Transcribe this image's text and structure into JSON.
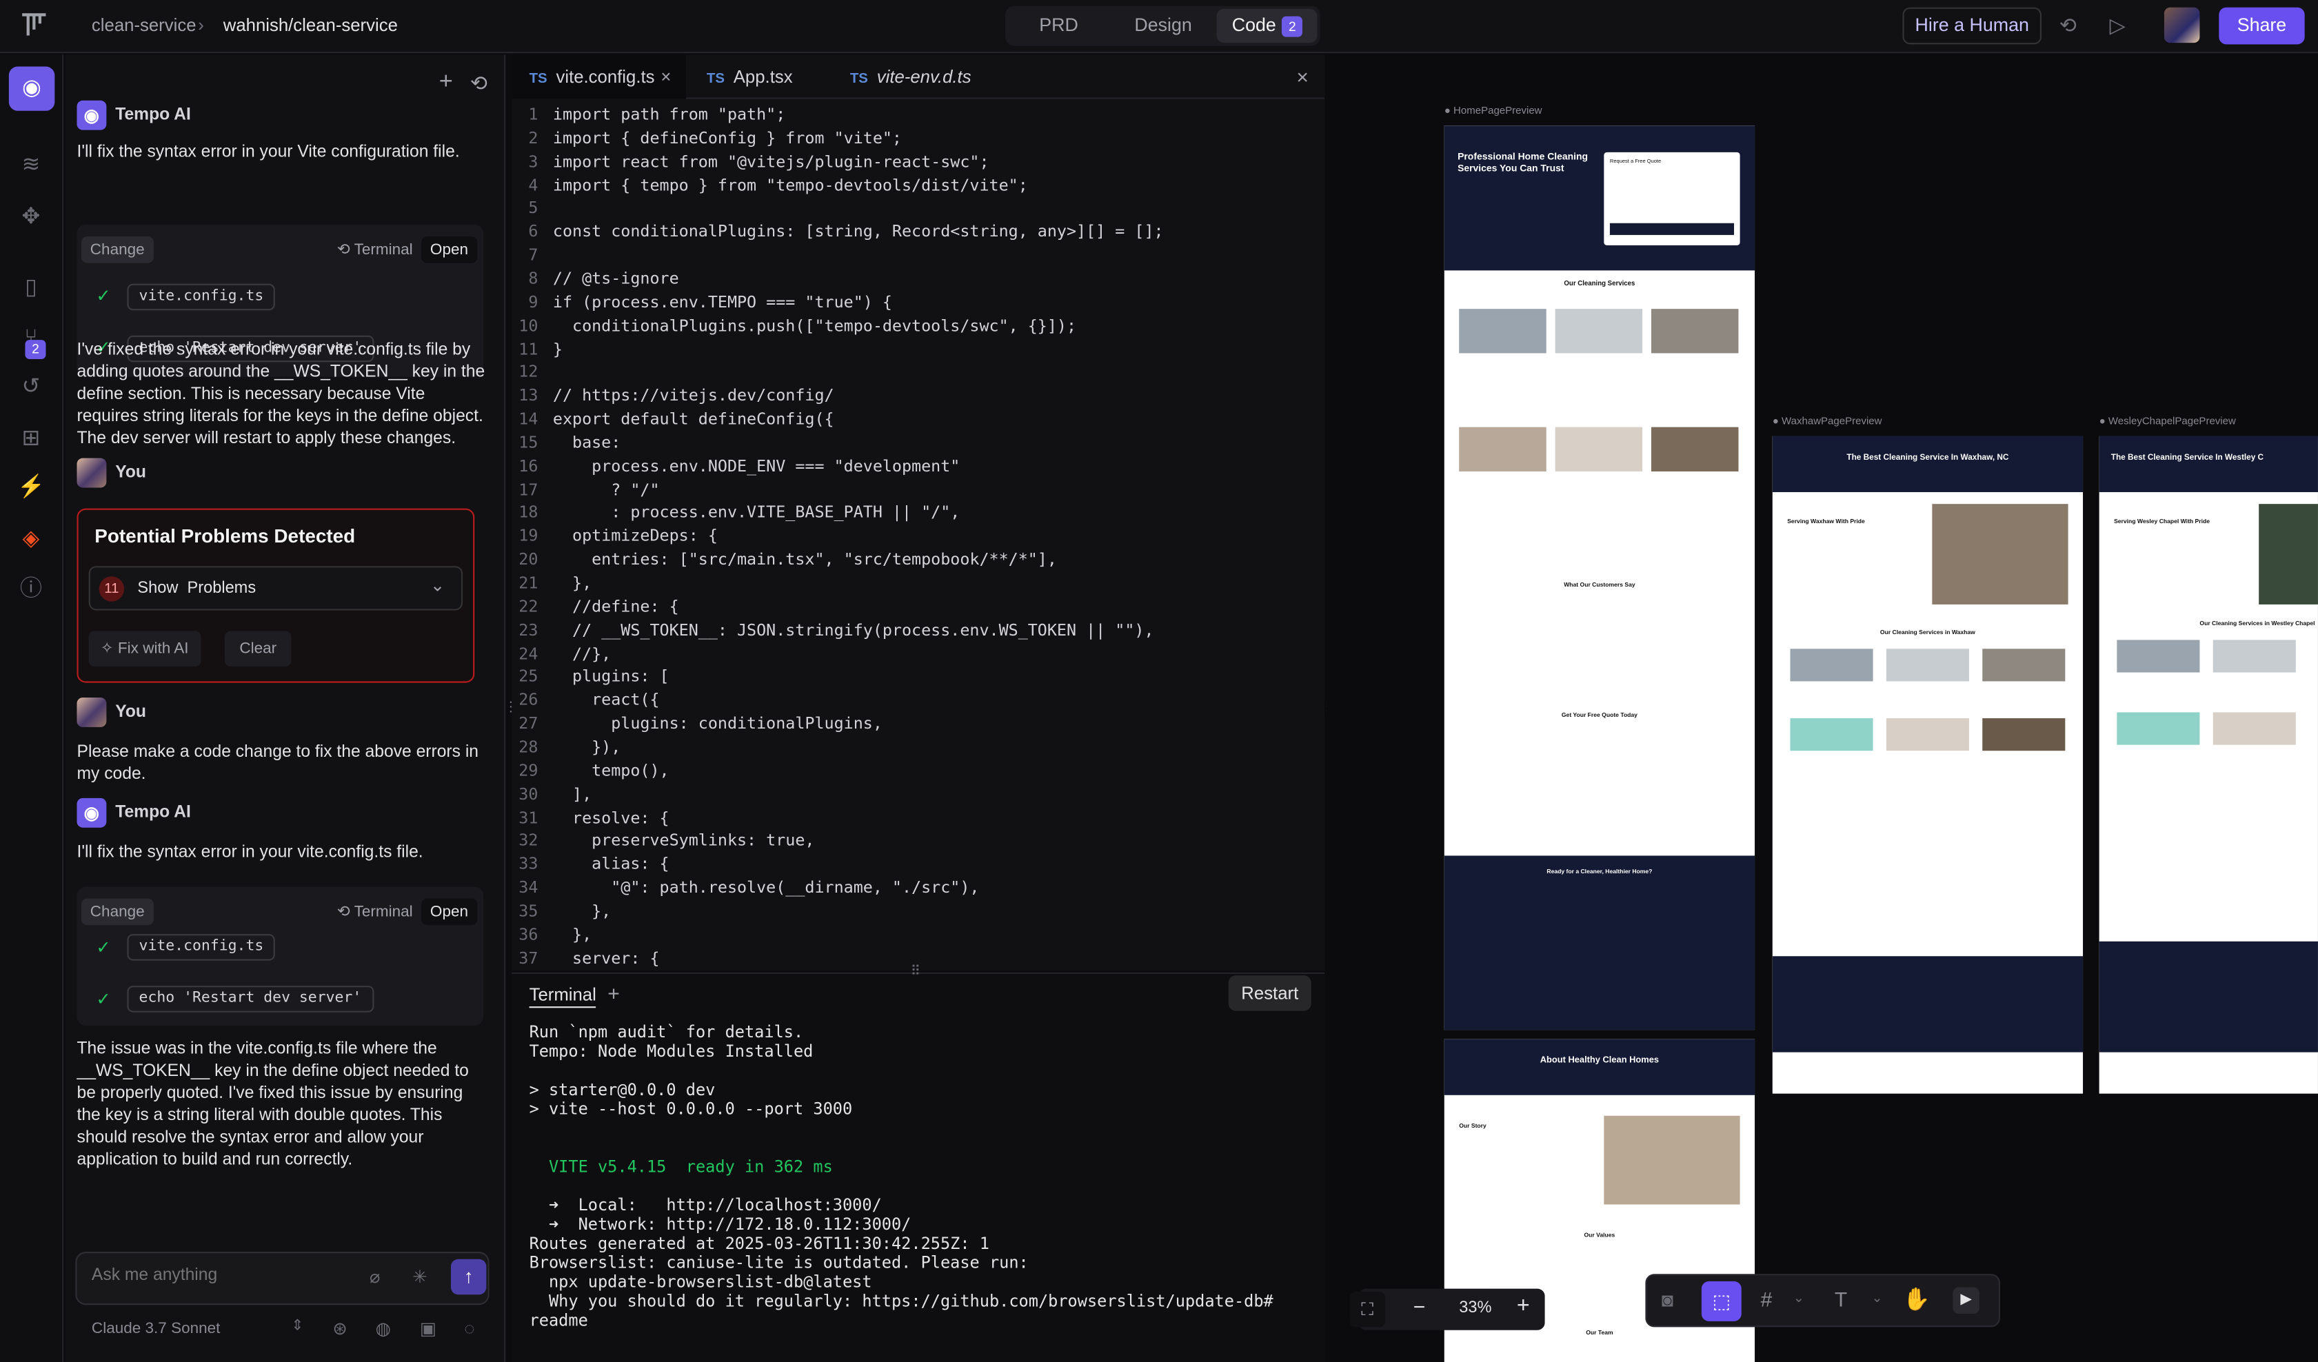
{
  "topbar": {
    "project": "clean-service",
    "repo": "wahnish/clean-service",
    "tabs": [
      "PRD",
      "Design",
      "Code"
    ],
    "code_badge": "2",
    "hire_label": "Hire a Human",
    "share_label": "Share"
  },
  "rail": {
    "badge": "2"
  },
  "chat": {
    "ai_name": "Tempo AI",
    "you_name": "You",
    "msg1": "I'll fix the syntax error in your Vite configuration file.",
    "change_label": "Change",
    "terminal_label": "Terminal",
    "open_label": "Open",
    "file1": "vite.config.ts",
    "cmd1": "echo 'Restart dev server'",
    "msg2": "I've fixed the syntax error in your vite.config.ts file by adding quotes around the __WS_TOKEN__ key in the define section. This is necessary because Vite requires string literals for the keys in the define object. The dev server will restart to apply these changes.",
    "problems_title": "Potential Problems Detected",
    "problems_count": "11",
    "problems_show": "Show  Problems",
    "fix_label": "Fix with AI",
    "clear_label": "Clear",
    "msg3": "Please make a code change to fix the above errors in my code.",
    "msg4": "I'll fix the syntax error in your vite.config.ts file.",
    "msg5": "The issue was in the vite.config.ts file where the __WS_TOKEN__ key in the define object needed to be properly quoted. I've fixed this issue by ensuring the key is a string literal with double quotes. This should resolve the syntax error and allow your application to build and run correctly.",
    "input_placeholder": "Ask me anything",
    "model": "Claude 3.7 Sonnet"
  },
  "editor": {
    "tabs": [
      "vite.config.ts",
      "App.tsx",
      "vite-env.d.ts"
    ],
    "lines": [
      "import path from \"path\";",
      "import { defineConfig } from \"vite\";",
      "import react from \"@vitejs/plugin-react-swc\";",
      "import { tempo } from \"tempo-devtools/dist/vite\";",
      "",
      "const conditionalPlugins: [string, Record<string, any>][] = [];",
      "",
      "// @ts-ignore",
      "if (process.env.TEMPO === \"true\") {",
      "  conditionalPlugins.push([\"tempo-devtools/swc\", {}]);",
      "}",
      "",
      "// https://vitejs.dev/config/",
      "export default defineConfig({",
      "  base:",
      "    process.env.NODE_ENV === \"development\"",
      "      ? \"/\"",
      "      : process.env.VITE_BASE_PATH || \"/\",",
      "  optimizeDeps: {",
      "    entries: [\"src/main.tsx\", \"src/tempobook/**/*\"],",
      "  },",
      "  //define: {",
      "  // __WS_TOKEN__: JSON.stringify(process.env.WS_TOKEN || \"\"),",
      "  //},",
      "  plugins: [",
      "    react({",
      "      plugins: conditionalPlugins,",
      "    }),",
      "    tempo(),",
      "  ],",
      "  resolve: {",
      "    preserveSymlinks: true,",
      "    alias: {",
      "      \"@\": path.resolve(__dirname, \"./src\"),",
      "    },",
      "  },",
      "  server: {"
    ]
  },
  "terminal": {
    "tab": "Terminal",
    "restart": "Restart",
    "lines": [
      "Run `npm audit` for details.",
      "Tempo: Node Modules Installed",
      "",
      "> starter@0.0.0 dev",
      "> vite --host 0.0.0.0 --port 3000",
      "",
      "",
      "  VITE v5.4.15  ready in 362 ms",
      "",
      "  ➜  Local:   http://localhost:3000/",
      "  ➜  Network: http://172.18.0.112:3000/",
      "Routes generated at 2025-03-26T11:30:42.255Z: 1",
      "Browserslist: caniuse-lite is outdated. Please run:",
      "  npx update-browserslist-db@latest",
      "  Why you should do it regularly: https://github.com/browserslist/update-db#",
      "readme"
    ]
  },
  "canvas": {
    "frames": [
      "HomePagePreview",
      "WaxhawPagePreview",
      "WesleyChapelPagePreview"
    ],
    "home_hero": "Professional Home Cleaning Services You Can Trust",
    "home_services": "Our Cleaning Services",
    "home_testimonials": "What Our Customers Say",
    "home_quote": "Get Your Free Quote Today",
    "home_cta": "Ready for a Cleaner, Healthier Home?",
    "about_title": "About Healthy Clean Homes",
    "about_story": "Our Story",
    "about_values": "Our Values",
    "about_team": "Our Team",
    "waxhaw_title": "The Best Cleaning Service In Waxhaw, NC",
    "waxhaw_serving": "Serving Waxhaw With Pride",
    "waxhaw_services": "Our Cleaning Services in Waxhaw",
    "wesley_title": "The Best Cleaning Service In Westley C",
    "wesley_serving": "Serving Wesley Chapel With Pride",
    "wesley_services": "Our Cleaning Services in Westley Chapel",
    "quote_form": "Request a Free Quote",
    "zoom": "33%"
  }
}
